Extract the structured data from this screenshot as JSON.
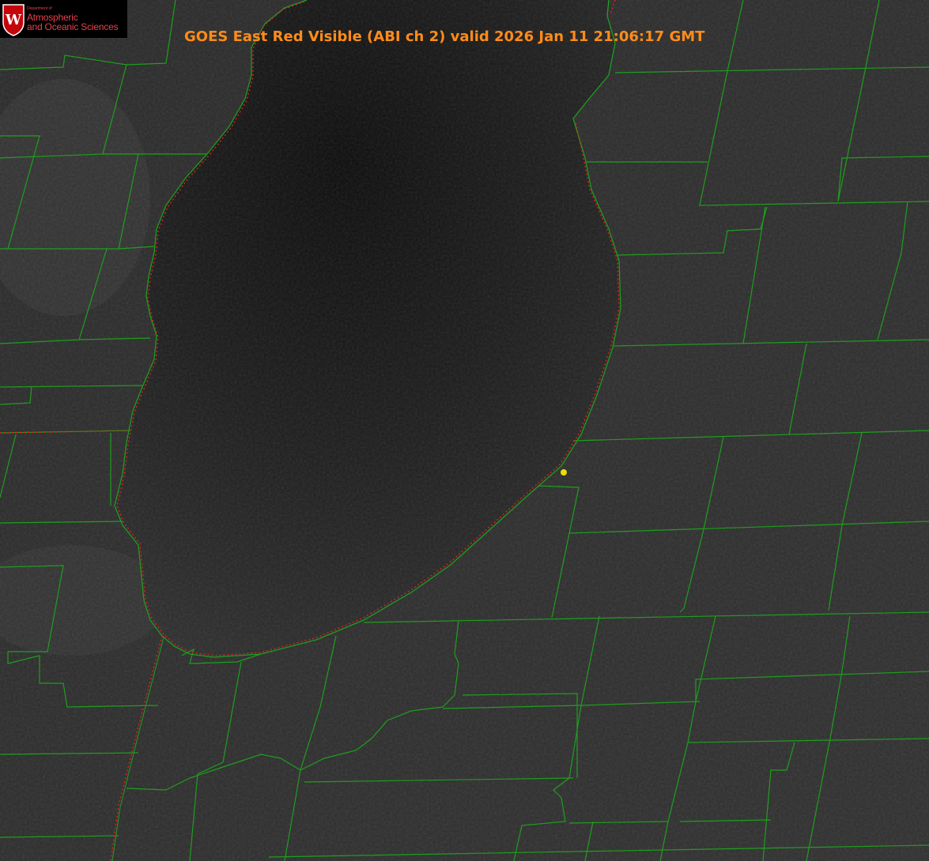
{
  "title": "GOES East Red Visible (ABI ch 2) valid 2026 Jan 11 21:06:17 GMT",
  "logo": {
    "crest_letter": "W",
    "department": "Department of",
    "line1": "Atmospheric",
    "line2": "and Oceanic Sciences"
  },
  "colors": {
    "title": "#ff8c1a",
    "county_lines": "#1e9e1e",
    "state_border": "#e02020",
    "marker": "#e8e000",
    "logo_text": "#e8414d",
    "crest": "#c5050c"
  },
  "legend": {
    "feature_layers": [
      "lake-michigan-shoreline",
      "county-boundaries",
      "state-boundary",
      "station-marker"
    ]
  }
}
